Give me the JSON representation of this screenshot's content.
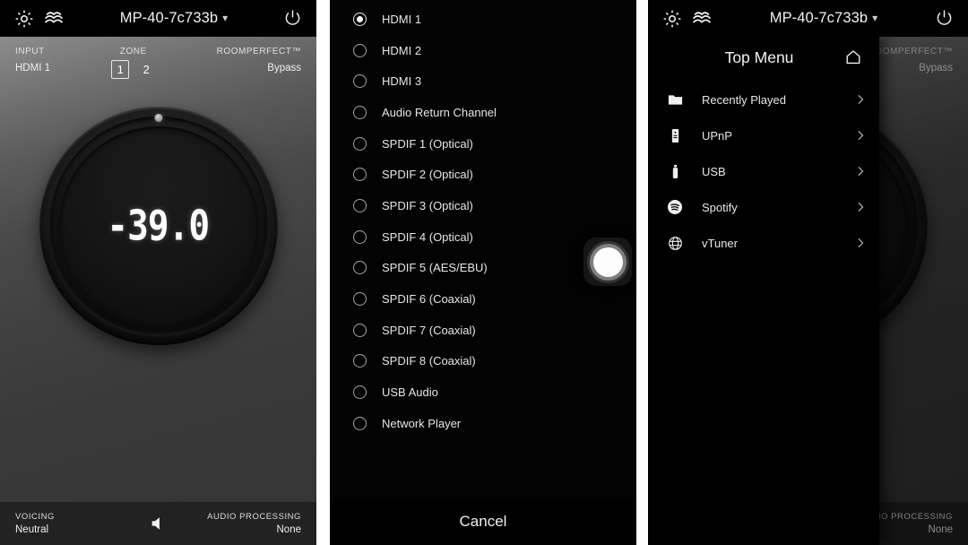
{
  "appbar": {
    "gear_icon": "gear-icon",
    "waves_icon": "roomperfect-waves-icon",
    "device_name": "MP-40-7c733b",
    "caret": "⌄",
    "power_icon": "power-icon"
  },
  "dial_screen": {
    "input": {
      "label": "INPUT",
      "value": "HDMI 1"
    },
    "zone": {
      "label": "ZONE",
      "options": [
        "1",
        "2"
      ],
      "selected": "1"
    },
    "roomperfect": {
      "label": "ROOMPERFECT™",
      "value": "Bypass"
    },
    "volume": {
      "value": "-39.0",
      "marker": "knob-position-marker"
    },
    "footer": {
      "voicing_label": "VOICING",
      "voicing_value": "Neutral",
      "mute_icon": "speaker-mute-icon",
      "processing_label": "AUDIO PROCESSING",
      "processing_value": "None"
    }
  },
  "input_picker": {
    "options": [
      {
        "label": "HDMI 1",
        "selected": true
      },
      {
        "label": "HDMI 2",
        "selected": false
      },
      {
        "label": "HDMI 3",
        "selected": false
      },
      {
        "label": "Audio Return Channel",
        "selected": false
      },
      {
        "label": "SPDIF 1 (Optical)",
        "selected": false
      },
      {
        "label": "SPDIF 2 (Optical)",
        "selected": false
      },
      {
        "label": "SPDIF 3 (Optical)",
        "selected": false
      },
      {
        "label": "SPDIF 4 (Optical)",
        "selected": false
      },
      {
        "label": "SPDIF 5 (AES/EBU)",
        "selected": false
      },
      {
        "label": "SPDIF 6 (Coaxial)",
        "selected": false
      },
      {
        "label": "SPDIF 7 (Coaxial)",
        "selected": false
      },
      {
        "label": "SPDIF 8 (Coaxial)",
        "selected": false
      },
      {
        "label": "USB Audio",
        "selected": false
      },
      {
        "label": "Network Player",
        "selected": false
      }
    ],
    "cancel_label": "Cancel",
    "touch_indicator": "touch-cursor-indicator"
  },
  "top_menu": {
    "title": "Top Menu",
    "home_icon": "home-icon",
    "items": [
      {
        "label": "Recently Played",
        "icon": "folder-icon"
      },
      {
        "label": "UPnP",
        "icon": "server-icon"
      },
      {
        "label": "USB",
        "icon": "usb-drive-icon"
      },
      {
        "label": "Spotify",
        "icon": "spotify-icon"
      },
      {
        "label": "vTuner",
        "icon": "globe-icon"
      }
    ]
  },
  "colors": {
    "appbar_bg": "#000000",
    "panel_bg": "#030303",
    "footer_bg": "#222222",
    "text_primary": "#f0f0f0",
    "text_secondary": "#dcdcdc",
    "gap": "#ffffff"
  }
}
